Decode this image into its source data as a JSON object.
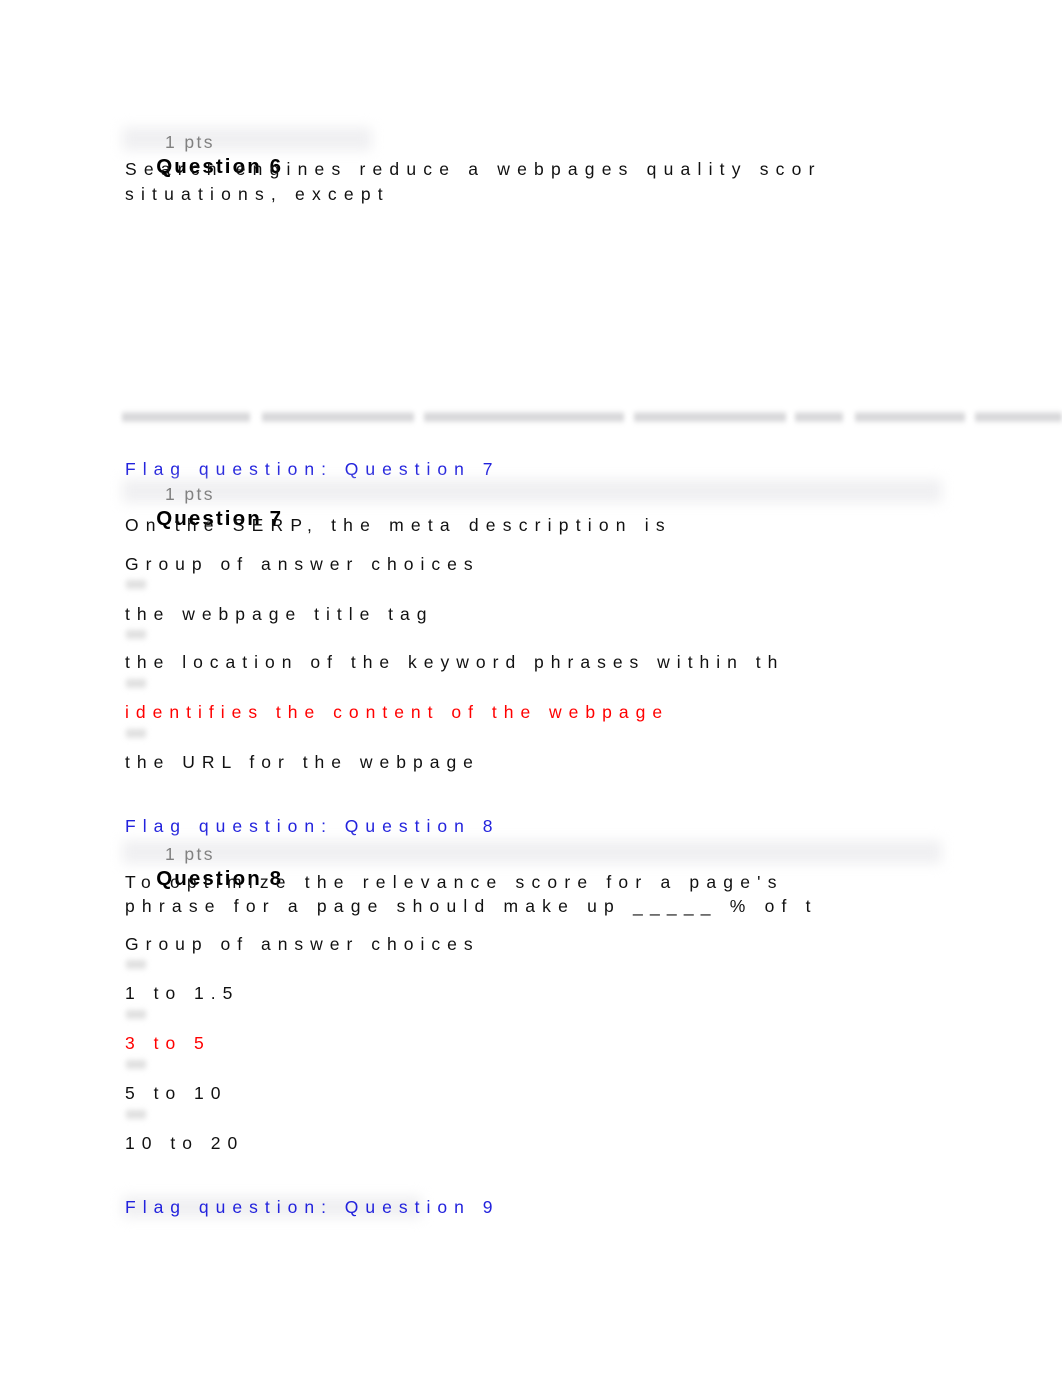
{
  "document": {
    "type": "quiz-page",
    "colors": {
      "link_blue": "#2222DD",
      "selected_red": "#FF0000",
      "text_black": "#111111",
      "points_gray": "#808080",
      "background": "#FFFFFF"
    }
  },
  "questions": [
    {
      "id": "q6",
      "heading": "Question 6",
      "points": "1 pts",
      "prompt_lines": [
        "Search engines reduce a webpages quality scor",
        "situations, except"
      ],
      "group_label": "",
      "choices": []
    },
    {
      "id": "q7",
      "flag": "Flag question: Question 7",
      "heading": "Question 7",
      "points": "1 pts",
      "prompt_lines": [
        "On the SERP, the meta description is"
      ],
      "group_label": "Group of answer choices",
      "choices": [
        {
          "text": "the webpage title tag",
          "selected": false
        },
        {
          "text": "the location of the keyword phrases within th",
          "selected": false
        },
        {
          "text": "identifies the content of the webpage",
          "selected": true
        },
        {
          "text": "the URL for the webpage",
          "selected": false
        }
      ]
    },
    {
      "id": "q8",
      "flag": "Flag question: Question 8",
      "heading": "Question 8",
      "points": "1 pts",
      "prompt_lines": [
        "To optimize the relevance score for a page's",
        "phrase for a page should make up _____ % of t"
      ],
      "group_label": "Group of answer choices",
      "choices": [
        {
          "text": "1 to 1.5",
          "selected": false
        },
        {
          "text": "3 to 5",
          "selected": true
        },
        {
          "text": "5 to 10",
          "selected": false
        },
        {
          "text": "10 to 20",
          "selected": false
        }
      ]
    }
  ],
  "trailing_flag": "Flag question: Question 9"
}
